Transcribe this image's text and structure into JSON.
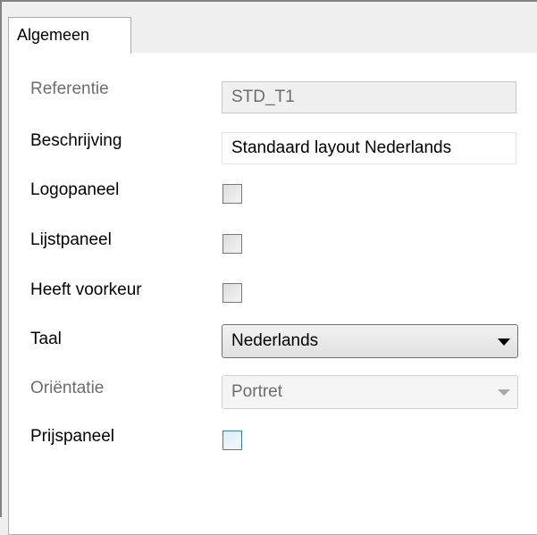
{
  "tab": {
    "label": "Algemeen"
  },
  "fields": {
    "referentie": {
      "label": "Referentie",
      "value": "STD_T1"
    },
    "beschrijving": {
      "label": "Beschrijving",
      "value": "Standaard layout Nederlands"
    },
    "logopaneel": {
      "label": "Logopaneel",
      "checked": false
    },
    "lijstpaneel": {
      "label": "Lijstpaneel",
      "checked": false
    },
    "heeft_voorkeur": {
      "label": "Heeft voorkeur",
      "checked": false
    },
    "taal": {
      "label": "Taal",
      "selected": "Nederlands"
    },
    "orientatie": {
      "label": "Oriëntatie",
      "selected": "Portret"
    },
    "prijspaneel": {
      "label": "Prijspaneel",
      "checked": false
    }
  },
  "colors": {
    "panel_background": "#ffffff",
    "window_background": "#f0f0f0",
    "disabled_text": "#6d6d6d",
    "focus_border": "#3c7fb1"
  }
}
